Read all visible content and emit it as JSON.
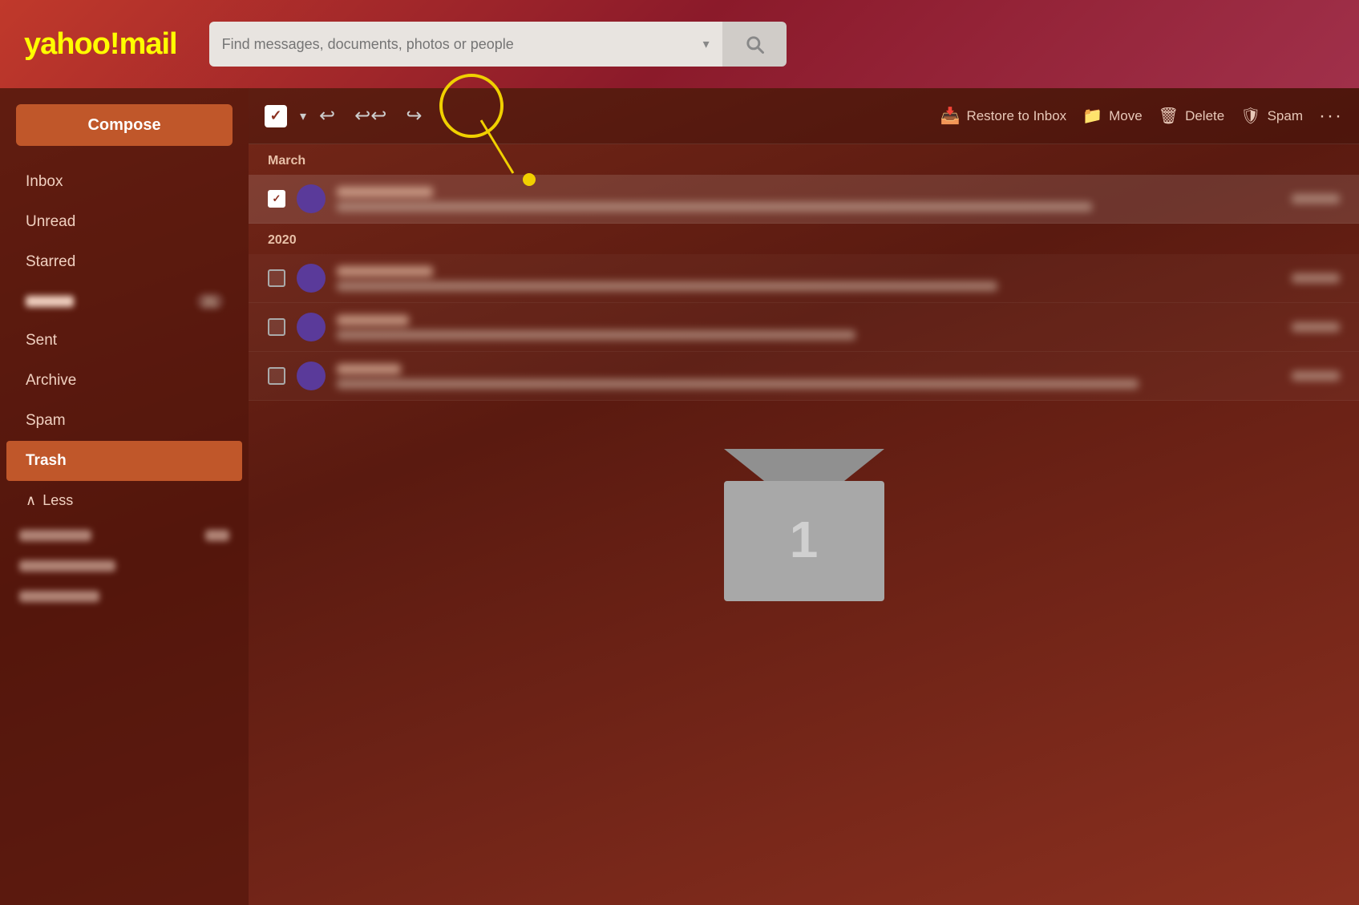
{
  "header": {
    "logo": "yahoo!mail",
    "search_placeholder": "Find messages, documents, photos or people"
  },
  "sidebar": {
    "compose_label": "Compose",
    "nav_items": [
      {
        "id": "inbox",
        "label": "Inbox",
        "badge": null,
        "active": false,
        "blurred": false
      },
      {
        "id": "unread",
        "label": "Unread",
        "badge": null,
        "active": false,
        "blurred": false
      },
      {
        "id": "starred",
        "label": "Starred",
        "badge": null,
        "active": false,
        "blurred": false
      },
      {
        "id": "drafts",
        "label": "Drafts",
        "badge": "21",
        "active": false,
        "blurred": true
      },
      {
        "id": "sent",
        "label": "Sent",
        "badge": null,
        "active": false,
        "blurred": false
      },
      {
        "id": "archive",
        "label": "Archive",
        "badge": null,
        "active": false,
        "blurred": false
      },
      {
        "id": "spam",
        "label": "Spam",
        "badge": null,
        "active": false,
        "blurred": false
      },
      {
        "id": "trash",
        "label": "Trash",
        "badge": null,
        "active": true,
        "blurred": false
      }
    ],
    "less_label": "Less"
  },
  "toolbar": {
    "select_all_checked": true,
    "restore_label": "Restore to Inbox",
    "move_label": "Move",
    "delete_label": "Delete",
    "spam_label": "Spam"
  },
  "email_groups": [
    {
      "date": "March",
      "emails": [
        {
          "id": 1,
          "checked": true,
          "blurred": true
        }
      ]
    },
    {
      "date": "2020",
      "emails": [
        {
          "id": 2,
          "checked": false,
          "blurred": true
        },
        {
          "id": 3,
          "checked": false,
          "blurred": true
        },
        {
          "id": 4,
          "checked": false,
          "blurred": true
        }
      ]
    }
  ],
  "empty_state": {
    "count": "1"
  },
  "colors": {
    "accent": "#c0572a",
    "sidebar_bg": "rgba(80,20,10,0.6)",
    "active_item": "#c0572a",
    "annotation": "#f0d000"
  }
}
